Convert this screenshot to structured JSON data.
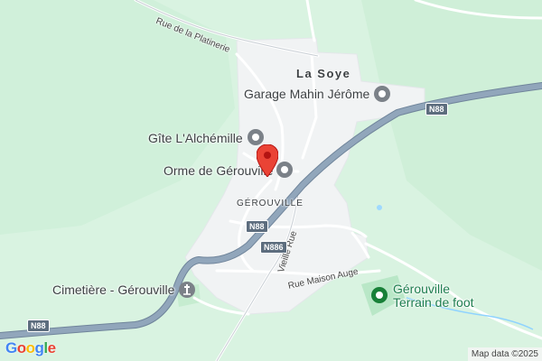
{
  "colors": {
    "background": "#d9f3e1",
    "settlement": "#f1f3f4",
    "highway": "#8aa0b5",
    "minor_road": "#ffffff",
    "poi_icon": "#5f6368",
    "park_icon": "#188038",
    "marker": "#ea4335"
  },
  "labels": {
    "place_main": "La Soye",
    "place_small": "Gérouville"
  },
  "pois": [
    {
      "name": "Garage Mahin Jérôme",
      "icon": "pin-circle-icon"
    },
    {
      "name": "Gîte L'Alchémille",
      "icon": "pin-circle-icon"
    },
    {
      "name": "Orme de Gérouville",
      "icon": "pin-circle-icon"
    },
    {
      "name": "Cimetière - Gérouville",
      "icon": "cemetery-icon"
    }
  ],
  "park_poi": {
    "line1": "Gérouville",
    "line2": "Terrain de foot",
    "icon": "park-icon"
  },
  "streets": {
    "platinerie": "Rue de la Platinerie",
    "vieille": "Vieille Rue",
    "maison_auge": "Rue Maison Auge"
  },
  "road_shields": [
    "N88",
    "N88",
    "N88",
    "N886"
  ],
  "attribution": {
    "logo": [
      "G",
      "o",
      "o",
      "g",
      "l",
      "e"
    ],
    "map_data": "Map data ©2025"
  }
}
